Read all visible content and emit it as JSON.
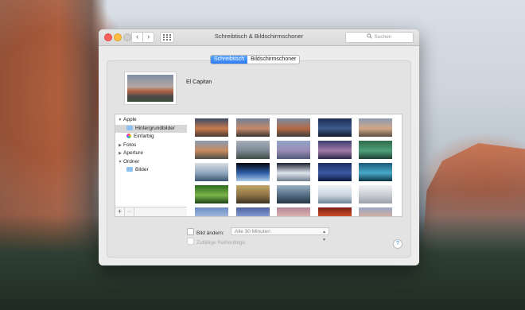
{
  "window": {
    "title": "Schreibtisch & Bildschirmschoner",
    "search_placeholder": "Suchen",
    "nav_back": "‹",
    "nav_forward": "›"
  },
  "tabs": [
    {
      "label": "Schreibtisch",
      "active": true
    },
    {
      "label": "Bildschirmschoner",
      "active": false
    }
  ],
  "current_wallpaper": {
    "name": "El Capitan"
  },
  "sidebar": {
    "items": [
      {
        "label": "Apple",
        "type": "group",
        "expanded": true
      },
      {
        "label": "Hintergrundbilder",
        "type": "folder",
        "selected": true
      },
      {
        "label": "Einfarbig",
        "type": "colorwheel"
      },
      {
        "label": "Fotos",
        "type": "group",
        "expanded": false
      },
      {
        "label": "Aperture",
        "type": "group",
        "expanded": false
      },
      {
        "label": "Ordner",
        "type": "group",
        "expanded": true
      },
      {
        "label": "Bilder",
        "type": "folder"
      }
    ],
    "add_label": "+",
    "remove_label": "−"
  },
  "thumbnails": [
    {
      "name": "wallpaper-1",
      "colors": [
        "#3c4a66",
        "#c97a4e",
        "#4a3b32"
      ]
    },
    {
      "name": "wallpaper-2",
      "colors": [
        "#6f7f96",
        "#c68a6a",
        "#3b3533"
      ]
    },
    {
      "name": "wallpaper-3",
      "colors": [
        "#7b8aa2",
        "#b56a45",
        "#3f3e3a"
      ]
    },
    {
      "name": "wallpaper-4",
      "colors": [
        "#1d2b55",
        "#3e5b8c",
        "#10182c"
      ]
    },
    {
      "name": "wallpaper-5",
      "colors": [
        "#8a9ab2",
        "#d2a685",
        "#5b5046"
      ]
    },
    {
      "name": "wallpaper-6",
      "colors": [
        "#8c9cb4",
        "#c78a5d",
        "#4c4d4a"
      ]
    },
    {
      "name": "wallpaper-7",
      "colors": [
        "#a6afba",
        "#7b8793",
        "#3f4c45"
      ]
    },
    {
      "name": "wallpaper-8",
      "colors": [
        "#8fa4c8",
        "#9b8bb5",
        "#505a76"
      ]
    },
    {
      "name": "wallpaper-9",
      "colors": [
        "#3a3f6c",
        "#a27aa8",
        "#2a2946"
      ]
    },
    {
      "name": "wallpaper-10",
      "colors": [
        "#2f6b4a",
        "#4fa07a",
        "#1f3f33"
      ]
    },
    {
      "name": "wallpaper-11",
      "colors": [
        "#d9dde3",
        "#8fa6bd",
        "#3c5671"
      ]
    },
    {
      "name": "wallpaper-12",
      "colors": [
        "#05070f",
        "#2f5ea8",
        "#aecbe8"
      ]
    },
    {
      "name": "wallpaper-13",
      "colors": [
        "#1b2230",
        "#dfe5ec",
        "#6e7d8d"
      ]
    },
    {
      "name": "wallpaper-14",
      "colors": [
        "#1d2f62",
        "#3a58a2",
        "#0d1a3b"
      ]
    },
    {
      "name": "wallpaper-15",
      "colors": [
        "#1d5b7b",
        "#4aa9c8",
        "#0e3448"
      ]
    },
    {
      "name": "wallpaper-16",
      "colors": [
        "#2d6a1e",
        "#7bb54a",
        "#1c4215"
      ]
    },
    {
      "name": "wallpaper-17",
      "colors": [
        "#c2a565",
        "#8c7246",
        "#3a3222"
      ]
    },
    {
      "name": "wallpaper-18",
      "colors": [
        "#9ab0c4",
        "#536d83",
        "#263442"
      ]
    },
    {
      "name": "wallpaper-19",
      "colors": [
        "#eef2f6",
        "#c9d4de",
        "#6e8296"
      ]
    },
    {
      "name": "wallpaper-20",
      "colors": [
        "#f0f1f3",
        "#c9ccd2",
        "#9aa1ab"
      ]
    },
    {
      "name": "wallpaper-21",
      "colors": [
        "#6d8cc4",
        "#a7bde0",
        "#384f7f"
      ]
    },
    {
      "name": "wallpaper-22",
      "colors": [
        "#4d62a0",
        "#8aa0d6",
        "#2a3766"
      ]
    },
    {
      "name": "wallpaper-23",
      "colors": [
        "#b5869a",
        "#e1b9b2",
        "#6d4f6c"
      ]
    },
    {
      "name": "wallpaper-24",
      "colors": [
        "#7a1a12",
        "#d8542c",
        "#2a0a08"
      ]
    },
    {
      "name": "wallpaper-25",
      "colors": [
        "#9aa6c2",
        "#d7b2a0",
        "#3e4664"
      ]
    }
  ],
  "options": {
    "change_picture_label": "Bild ändern:",
    "interval_value": "Alle 30 Minuten",
    "random_order_label": "Zufällige Reihenfolge",
    "help_label": "?"
  }
}
